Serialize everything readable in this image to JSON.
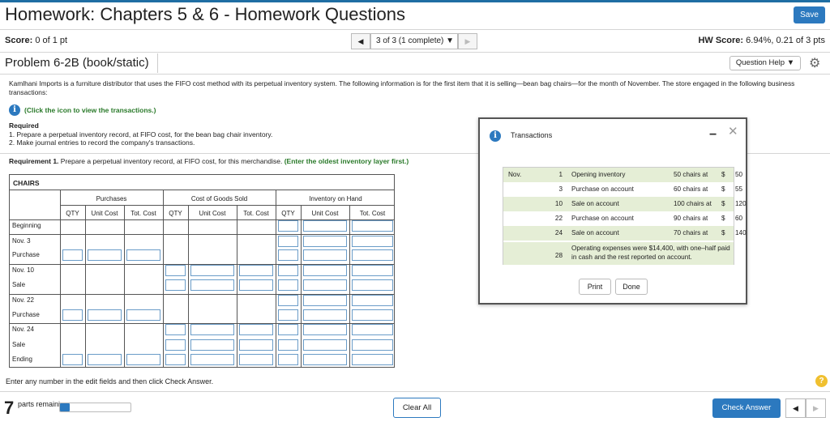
{
  "header": {
    "title": "Homework: Chapters 5 & 6 - Homework Questions",
    "save_label": "Save"
  },
  "score_bar": {
    "score_label": "Score:",
    "score_value": "0 of 1 pt",
    "question_nav": "3 of 3 (1 complete)",
    "hw_score_label": "HW Score:",
    "hw_score_value": "6.94%, 0.21 of 3 pts"
  },
  "problem": {
    "title": "Problem 6-2B (book/static)",
    "question_help_label": "Question Help"
  },
  "content": {
    "intro": "Kamlhani Imports is a furniture distributor that uses the FIFO cost method with its perpetual inventory system. The following information is for the first item that it is selling—bean bag chairs—for the month of November. The store engaged in the following business transactions:",
    "click_icon_text": "(Click the icon to view the transactions.)",
    "required_heading": "Required",
    "required_1": "1. Prepare a perpetual inventory record, at FIFO cost, for the bean bag chair inventory.",
    "required_2": "2. Make journal entries to record the company's transactions.",
    "req1_label": "Requirement 1.",
    "req1_text": "Prepare a perpetual inventory record, at FIFO cost, for this merchandise.",
    "req1_hint": "(Enter the oldest inventory layer first.)"
  },
  "ledger": {
    "caption": "CHAIRS",
    "groups": [
      "Purchases",
      "Cost of Goods Sold",
      "Inventory on Hand"
    ],
    "subheaders": [
      "QTY",
      "Unit Cost",
      "Tot. Cost",
      "QTY",
      "Unit Cost",
      "Tot. Cost",
      "QTY",
      "Unit Cost",
      "Tot. Cost"
    ],
    "row_labels": [
      "Beginning",
      "Nov. 3",
      "Purchase",
      "Nov. 10",
      "Sale",
      "Nov. 22",
      "Purchase",
      "Nov. 24",
      "Sale",
      "Ending"
    ]
  },
  "footer": {
    "instruction": "Enter any number in the edit fields and then click Check Answer.",
    "parts_count": "7",
    "parts_label": "parts remaining",
    "progress_fraction": 0.14,
    "clear_all_label": "Clear All",
    "check_answer_label": "Check Answer"
  },
  "modal": {
    "title": "Transactions",
    "month": "Nov.",
    "rows": [
      {
        "day": "1",
        "desc": "Opening inventory",
        "qty": "50 chairs at",
        "cur": "$",
        "price": "50"
      },
      {
        "day": "3",
        "desc": "Purchase on account",
        "qty": "60 chairs at",
        "cur": "$",
        "price": "55"
      },
      {
        "day": "10",
        "desc": "Sale on account",
        "qty": "100 chairs at",
        "cur": "$",
        "price": "120"
      },
      {
        "day": "22",
        "desc": "Purchase on account",
        "qty": "90 chairs at",
        "cur": "$",
        "price": "60"
      },
      {
        "day": "24",
        "desc": "Sale on account",
        "qty": "70 chairs at",
        "cur": "$",
        "price": "140"
      }
    ],
    "last_row": {
      "day": "28",
      "desc": "Operating expenses were $14,400, with one–half paid in cash and the rest reported on account."
    },
    "print_label": "Print",
    "done_label": "Done"
  },
  "colors": {
    "accent": "#2c79bf",
    "hint_green": "#2a7a2a",
    "row_highlight": "#e5eed6",
    "help_yellow": "#f0c030"
  }
}
